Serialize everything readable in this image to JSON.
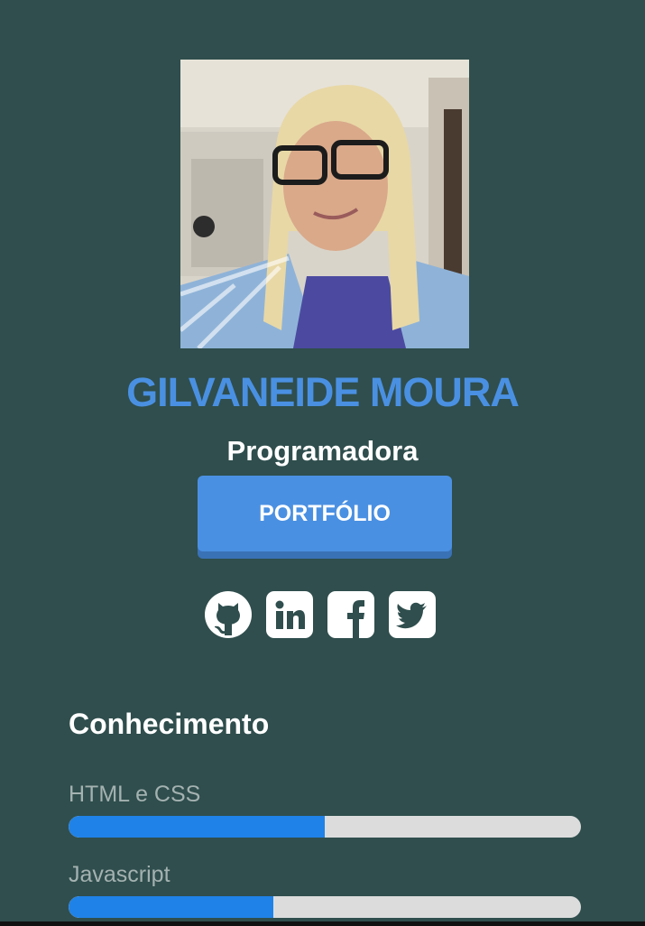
{
  "profile": {
    "name": "GILVANEIDE MOURA",
    "role": "Programadora"
  },
  "portfolio_button": {
    "label": "PORTFÓLIO"
  },
  "socials": [
    {
      "icon": "github-icon"
    },
    {
      "icon": "linkedin-icon"
    },
    {
      "icon": "facebook-icon"
    },
    {
      "icon": "twitter-icon"
    }
  ],
  "knowledge": {
    "title": "Conhecimento",
    "skills": [
      {
        "label": "HTML e CSS",
        "level_percent": 50
      },
      {
        "label": "Javascript",
        "level_percent": 40
      }
    ]
  },
  "colors": {
    "background": "#2f4e4d",
    "accent": "#4a90e2",
    "bar_fill": "#1f82e8",
    "bar_track": "#dcdcdc"
  }
}
